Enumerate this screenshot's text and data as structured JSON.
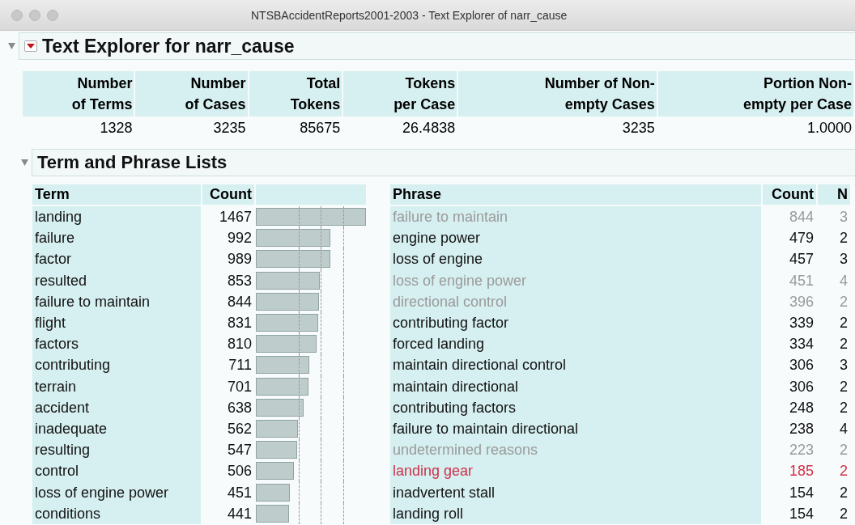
{
  "window": {
    "title": "NTSBAccidentReports2001-2003 - Text Explorer of narr_cause"
  },
  "report": {
    "title": "Text Explorer for narr_cause",
    "expanded": true,
    "summary": {
      "columns": [
        [
          "Number",
          "of Terms"
        ],
        [
          "Number",
          "of Cases"
        ],
        [
          "Total",
          "Tokens"
        ],
        [
          "Tokens",
          "per Case"
        ],
        [
          "Number of Non-",
          "empty Cases"
        ],
        [
          "Portion Non-",
          "empty per Case"
        ]
      ],
      "values": [
        "1328",
        "3235",
        "85675",
        "26.4838",
        "3235",
        "1.0000"
      ]
    },
    "lists": {
      "title": "Term and Phrase Lists",
      "expanded": true,
      "terms": {
        "columns": [
          "Term",
          "Count"
        ],
        "rows": [
          {
            "term": "landing",
            "count": "1467"
          },
          {
            "term": "failure",
            "count": "992"
          },
          {
            "term": "factor",
            "count": "989"
          },
          {
            "term": "resulted",
            "count": "853"
          },
          {
            "term": "failure to maintain",
            "count": "844"
          },
          {
            "term": "flight",
            "count": "831"
          },
          {
            "term": "factors",
            "count": "810"
          },
          {
            "term": "contributing",
            "count": "711"
          },
          {
            "term": "terrain",
            "count": "701"
          },
          {
            "term": "accident",
            "count": "638"
          },
          {
            "term": "inadequate",
            "count": "562"
          },
          {
            "term": "resulting",
            "count": "547"
          },
          {
            "term": "control",
            "count": "506"
          },
          {
            "term": "loss of engine power",
            "count": "451"
          },
          {
            "term": "conditions",
            "count": "441"
          }
        ]
      },
      "phrases": {
        "columns": [
          "Phrase",
          "Count",
          "N"
        ],
        "rows": [
          {
            "phrase": "failure to maintain",
            "count": "844",
            "n": "3",
            "kind": "dimmed"
          },
          {
            "phrase": "engine power",
            "count": "479",
            "n": "2",
            "kind": "plain"
          },
          {
            "phrase": "loss of engine",
            "count": "457",
            "n": "3",
            "kind": "plain"
          },
          {
            "phrase": "loss of engine power",
            "count": "451",
            "n": "4",
            "kind": "dimmed"
          },
          {
            "phrase": "directional control",
            "count": "396",
            "n": "2",
            "kind": "dimmed"
          },
          {
            "phrase": "contributing factor",
            "count": "339",
            "n": "2",
            "kind": "plain"
          },
          {
            "phrase": "forced landing",
            "count": "334",
            "n": "2",
            "kind": "plain"
          },
          {
            "phrase": "maintain directional control",
            "count": "306",
            "n": "3",
            "kind": "plain"
          },
          {
            "phrase": "maintain directional",
            "count": "306",
            "n": "2",
            "kind": "plain"
          },
          {
            "phrase": "contributing factors",
            "count": "248",
            "n": "2",
            "kind": "plain"
          },
          {
            "phrase": "failure to maintain directional",
            "count": "238",
            "n": "4",
            "kind": "plain"
          },
          {
            "phrase": "undetermined reasons",
            "count": "223",
            "n": "2",
            "kind": "dimmed"
          },
          {
            "phrase": "landing gear",
            "count": "185",
            "n": "2",
            "kind": "marked"
          },
          {
            "phrase": "inadvertent stall",
            "count": "154",
            "n": "2",
            "kind": "plain"
          },
          {
            "phrase": "landing roll",
            "count": "154",
            "n": "2",
            "kind": "plain"
          }
        ]
      }
    }
  }
}
